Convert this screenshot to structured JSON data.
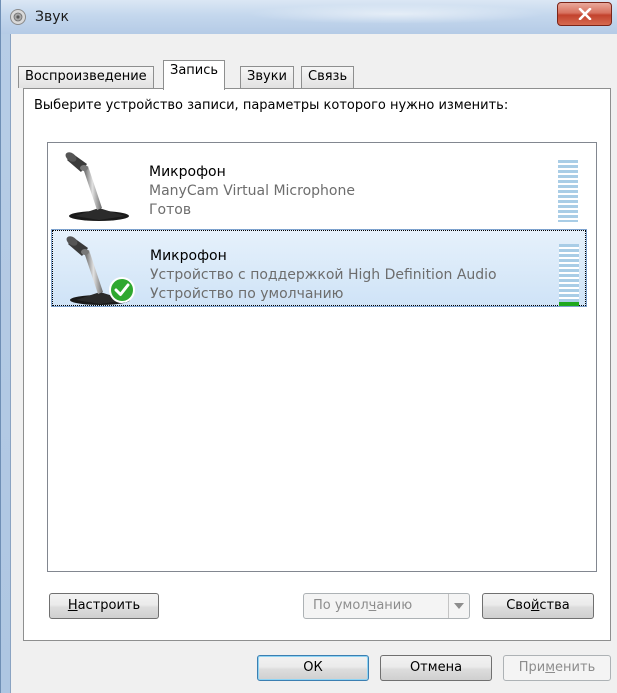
{
  "window": {
    "title": "Звук"
  },
  "tabs": [
    {
      "label": "Воспроизведение",
      "active": false
    },
    {
      "label": "Запись",
      "active": true
    },
    {
      "label": "Звуки",
      "active": false
    },
    {
      "label": "Связь",
      "active": false
    }
  ],
  "instruction": "Выберите устройство записи, параметры которого нужно изменить:",
  "devices": [
    {
      "name": "Микрофон",
      "description": "ManyCam Virtual Microphone",
      "status": "Готов",
      "default": false,
      "selected": false,
      "level": 0
    },
    {
      "name": "Микрофон",
      "description": "Устройство с поддержкой High Definition Audio",
      "status": "Устройство по умолчанию",
      "default": true,
      "selected": true,
      "level": 0.06
    }
  ],
  "buttons": {
    "configure": {
      "pre": "",
      "mnemonic": "Н",
      "post": "астроить"
    },
    "set_default": {
      "pre": "По умол",
      "mnemonic": "ч",
      "post": "анию"
    },
    "properties": {
      "pre": "Сво",
      "mnemonic": "й",
      "post": "ства"
    },
    "ok": "ОК",
    "cancel": "Отмена",
    "apply": {
      "pre": "При",
      "mnemonic": "м",
      "post": "енить"
    }
  },
  "colors": {
    "meter_inactive": "#a9cde6",
    "meter_active": "#1ea81e",
    "selection_border": "#7da2ce",
    "close_button": "#c2422d"
  },
  "icons": [
    "speaker-icon",
    "close-icon",
    "microphone-icon",
    "default-checkmark-icon",
    "dropdown-arrow-icon"
  ]
}
